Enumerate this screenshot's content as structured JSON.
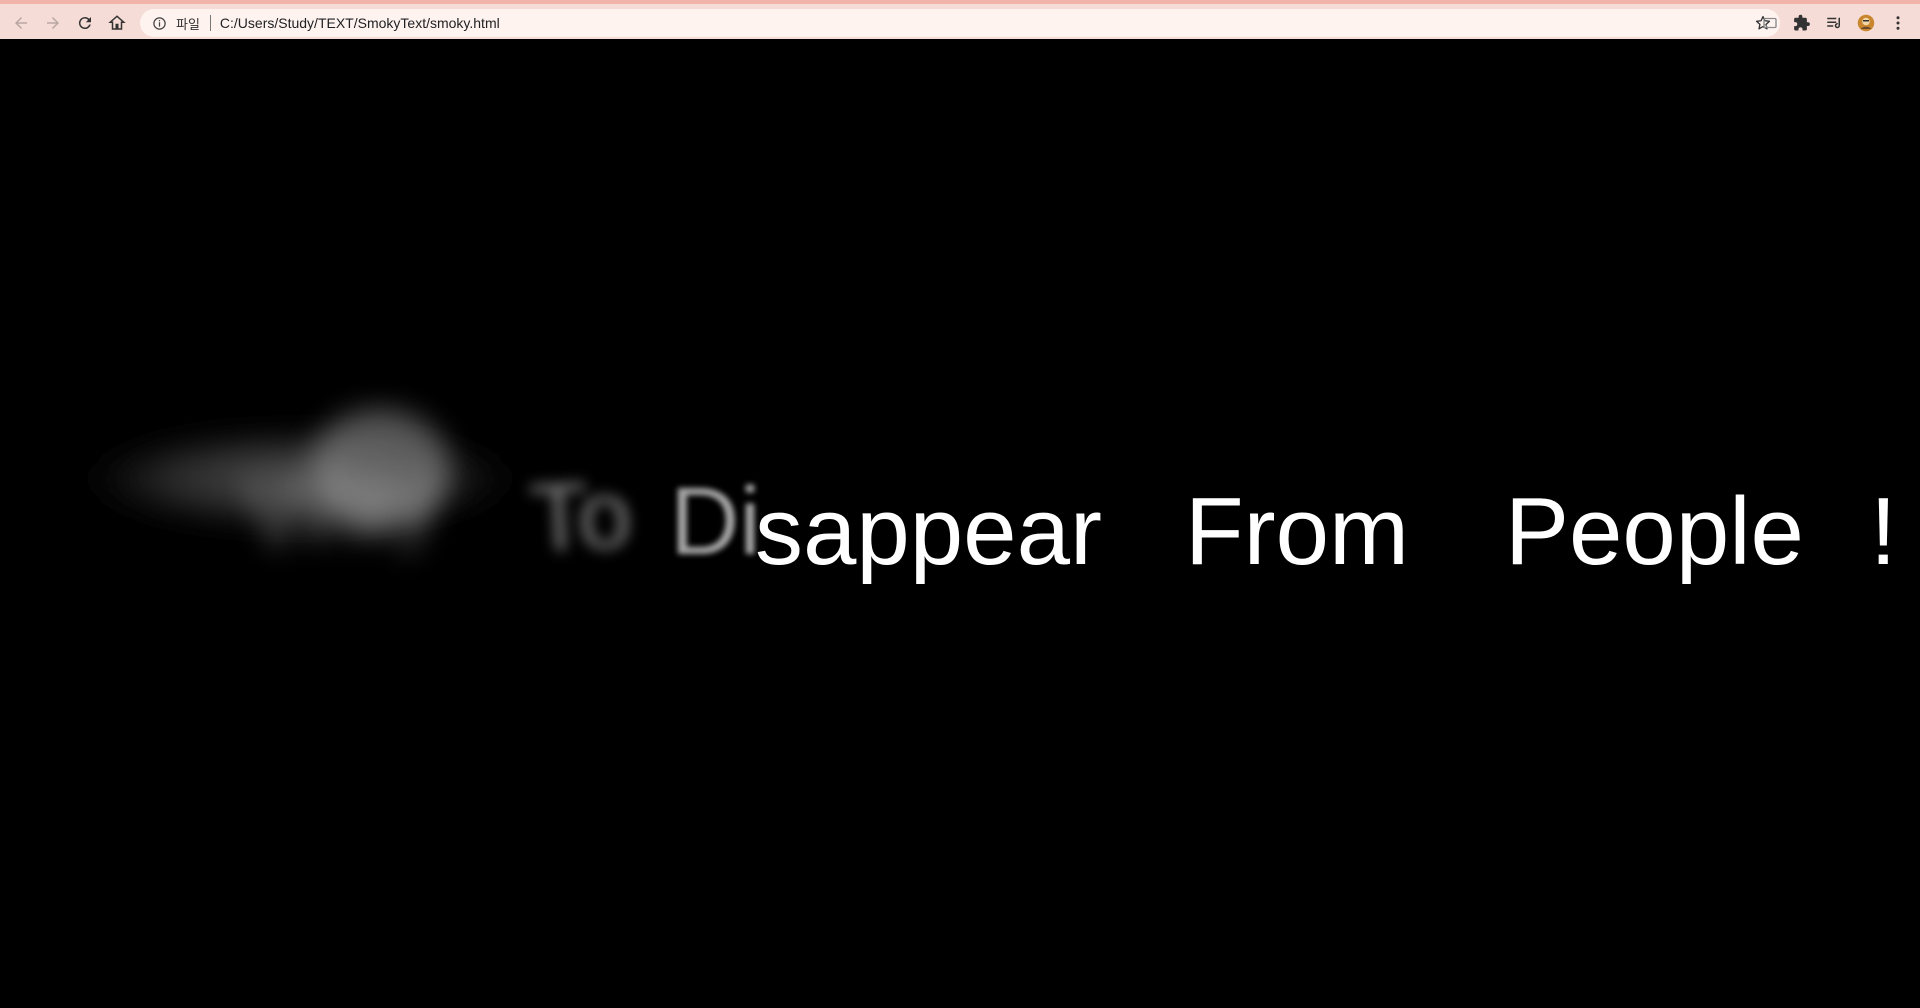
{
  "browser": {
    "address_chip": "파일",
    "url": "C:/Users/Study/TEXT/SmokyText/smoky.html"
  },
  "page": {
    "smoky_text": {
      "blurred_words": [
        "Way",
        "To",
        "Di"
      ],
      "sharp_words": [
        "sappear",
        "From",
        "People",
        "!"
      ]
    }
  },
  "icons": [
    "back-icon",
    "forward-icon",
    "reload-icon",
    "home-icon",
    "info-icon",
    "star-icon",
    "cast-icon",
    "extensions-icon",
    "reading-list-icon",
    "profile-avatar",
    "menu-icon"
  ]
}
